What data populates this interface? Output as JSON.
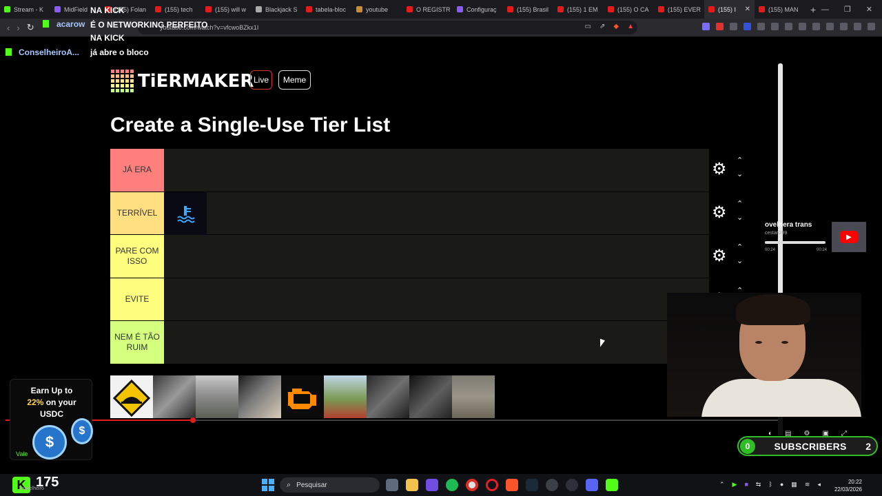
{
  "browser": {
    "tabs": [
      {
        "label": "Stream - K",
        "color": "#53fc18"
      },
      {
        "label": "MidField",
        "color": "#8b5cf6"
      },
      {
        "label": "(155) Folan",
        "color": "#e31b1b"
      },
      {
        "label": "(155) tech",
        "color": "#e31b1b"
      },
      {
        "label": "(155) will w",
        "color": "#e31b1b"
      },
      {
        "label": "Blackjack S",
        "color": "#aaaaaa"
      },
      {
        "label": "tabela-bloc",
        "color": "#e31b1b"
      },
      {
        "label": "youtube",
        "color": "#c98b33"
      },
      {
        "label": "O REGISTR",
        "color": "#e31b1b"
      },
      {
        "label": "Configuraç",
        "color": "#8b5cf6"
      },
      {
        "label": "(155) Brasil",
        "color": "#e31b1b"
      },
      {
        "label": "(155) 1 EM",
        "color": "#e31b1b"
      },
      {
        "label": "(155) O CA",
        "color": "#e31b1b"
      },
      {
        "label": "(155) EVER",
        "color": "#e31b1b"
      },
      {
        "label": "(155) I",
        "color": "#e31b1b"
      },
      {
        "label": "(155) MAN",
        "color": "#e31b1b"
      }
    ],
    "new_tab": "+",
    "url": "youtube.com/watch?v=vfcwoBZkx1I",
    "window_controls": [
      "—",
      "❐",
      "✕"
    ]
  },
  "chat": {
    "user1": "acarow",
    "user2": "ConselheiroA...",
    "lines": [
      "NA KICK",
      "É O NETWORKING PERFEITO",
      "NA KICK",
      "já abre o bloco"
    ]
  },
  "tiermaker": {
    "logo": "TiERMAKER",
    "live_label": "Live",
    "meme_label": "Meme",
    "title": "Create a Single-Use Tier List",
    "tiers": [
      {
        "label": "JÁ ERA",
        "color": "#ff7f7f"
      },
      {
        "label": "TERRÍVEL",
        "color": "#ffdf7f"
      },
      {
        "label": "PARE COM ISSO",
        "color": "#ffff7f"
      },
      {
        "label": "EVITE",
        "color": "#ffff7f"
      },
      {
        "label": "NEM É TÃO RUIM",
        "color": "#d5ff7f"
      }
    ],
    "gear_icon": "⚙",
    "up_arrow": "⌃",
    "down_arrow": "⌄"
  },
  "ad": {
    "line1": "Earn Up to",
    "pct": "22%",
    "line2": "on your",
    "line3": "USDC",
    "cta": "Vale",
    "coin_symbol": "$"
  },
  "mini_player": {
    "title": "ovelhera trans",
    "channel": "cestari299",
    "time_left": "00:24",
    "time_right": "00:24"
  },
  "subscribers": {
    "left": "0",
    "label": "SUBSCRIBERS",
    "right": "2"
  },
  "taskbar": {
    "kick_letter": "K",
    "viewers": "175",
    "viewers_sub": "conselheiro",
    "search_placeholder": "Pesquisar",
    "time": "20:22",
    "date": "22/03/2026"
  }
}
